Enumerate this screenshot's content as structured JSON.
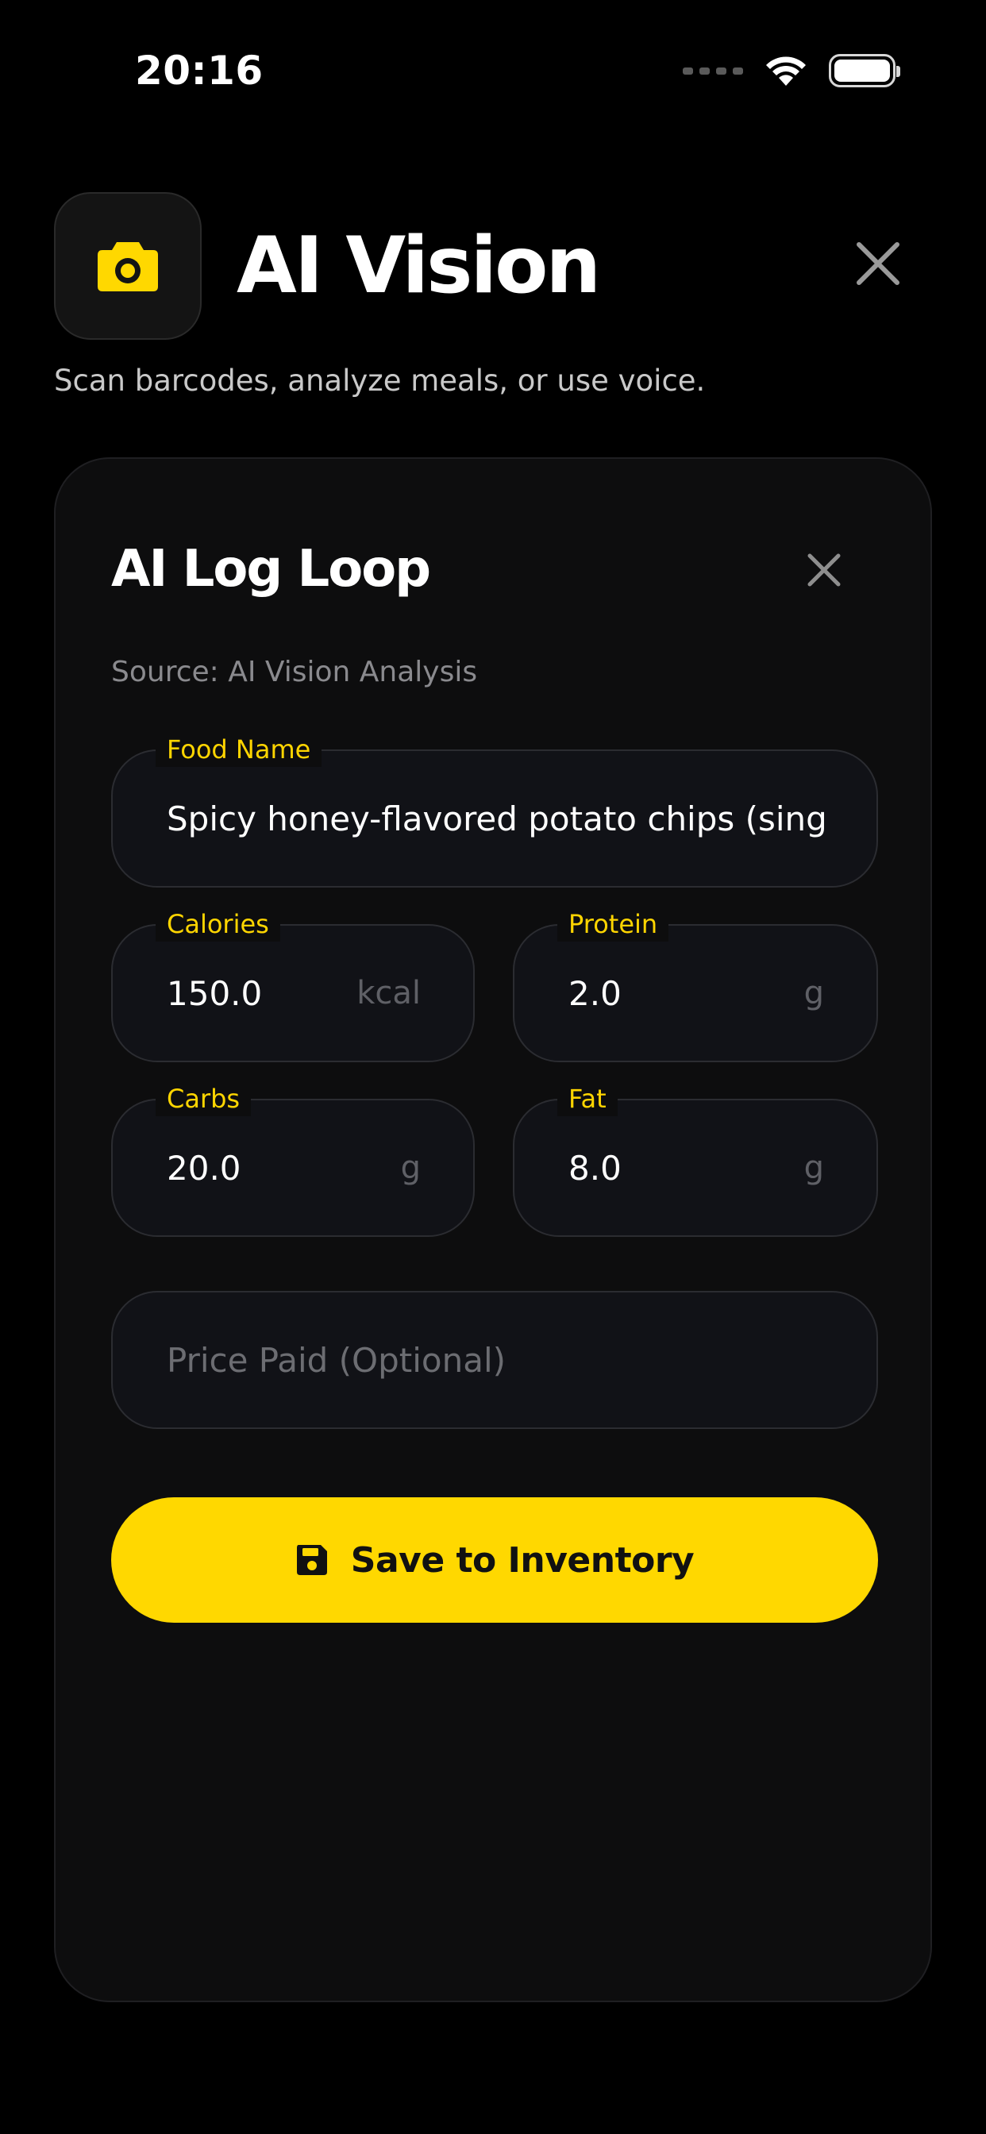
{
  "status_bar": {
    "time": "20:16"
  },
  "header": {
    "title": "AI Vision",
    "subtitle": "Scan barcodes, analyze meals, or use voice."
  },
  "card": {
    "title": "AI Log Loop",
    "source": "Source: AI Vision Analysis",
    "fields": {
      "food_name": {
        "label": "Food Name",
        "value": "Spicy honey-flavored potato chips (single serving)"
      },
      "calories": {
        "label": "Calories",
        "value": "150.0",
        "unit": "kcal"
      },
      "protein": {
        "label": "Protein",
        "value": "2.0",
        "unit": "g"
      },
      "carbs": {
        "label": "Carbs",
        "value": "20.0",
        "unit": "g"
      },
      "fat": {
        "label": "Fat",
        "value": "8.0",
        "unit": "g"
      },
      "price": {
        "placeholder": "Price Paid (Optional)"
      }
    },
    "save_label": "Save to Inventory"
  },
  "colors": {
    "accent": "#ffd800",
    "background": "#000000",
    "card": "#0d0d0e",
    "field": "#111217"
  },
  "icons": {
    "app": "camera-icon",
    "close": "close-icon",
    "save": "floppy-disk-icon"
  }
}
